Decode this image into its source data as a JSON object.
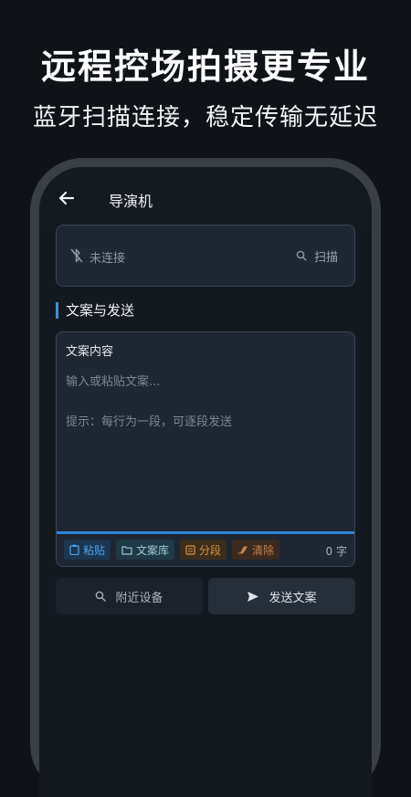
{
  "promo": {
    "title": "远程控场拍摄更专业",
    "subtitle": "蓝牙扫描连接，稳定传输无延迟"
  },
  "app_bar": {
    "back_icon": "arrow-left-icon",
    "title": "导演机"
  },
  "connection": {
    "status_icon": "bluetooth-disabled-icon",
    "status": "未连接",
    "scan_icon": "search-icon",
    "scan_label": "扫描"
  },
  "script_section": {
    "title": "文案与发送",
    "accent_color": "#3b8fe0"
  },
  "editor": {
    "label": "文案内容",
    "placeholder": "输入或粘贴文案...\n\n提示：每行为一段，可逐段发送",
    "char_count": "0 字",
    "toolbar": [
      {
        "icon": "clipboard-icon",
        "label": "粘贴"
      },
      {
        "icon": "folder-icon",
        "label": "文案库"
      },
      {
        "icon": "split-icon",
        "label": "分段"
      },
      {
        "icon": "eraser-icon",
        "label": "清除"
      }
    ]
  },
  "actions": {
    "nearby": {
      "icon": "search-icon",
      "label": "附近设备"
    },
    "send": {
      "icon": "send-icon",
      "label": "发送文案"
    }
  }
}
